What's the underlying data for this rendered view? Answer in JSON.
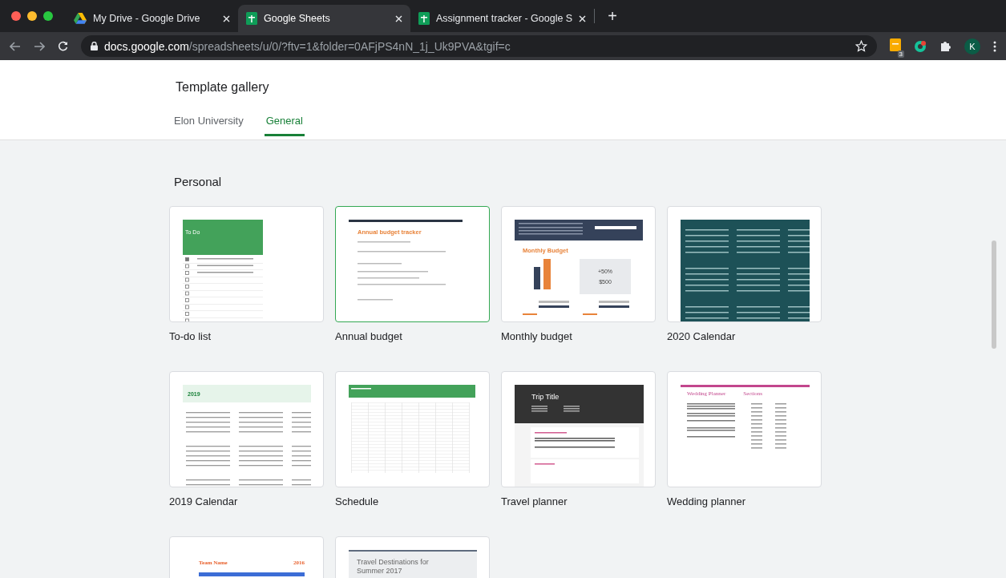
{
  "browser": {
    "tabs": [
      {
        "title": "My Drive - Google Drive",
        "selected": false
      },
      {
        "title": "Google Sheets",
        "selected": true
      },
      {
        "title": "Assignment tracker - Google S",
        "selected": false
      }
    ],
    "new_tab": "+",
    "url_host": "docs.google.com",
    "url_path": "/spreadsheets/u/0/?ftv=1&folder=0AFjPS4nN_1j_Uk9PVA&tgif=c",
    "extension_badge": "3",
    "avatar": "K"
  },
  "page": {
    "title": "Template gallery",
    "tabs": [
      {
        "label": "Elon University",
        "selected": false
      },
      {
        "label": "General",
        "selected": true
      }
    ],
    "section": "Personal",
    "templates": [
      {
        "name": "To-do list",
        "preview": {
          "kind": "todo",
          "title": "To Do",
          "checks": [
            true,
            false,
            false,
            false,
            false,
            false,
            false,
            false,
            false,
            false
          ]
        },
        "selected": false
      },
      {
        "name": "Annual budget",
        "preview": {
          "kind": "annual",
          "title": "Annual budget tracker"
        },
        "selected": true
      },
      {
        "name": "Monthly budget",
        "preview": {
          "kind": "monthly",
          "title": "Monthly Budget",
          "stat_1": "+50%",
          "stat_2": "$500"
        },
        "selected": false
      },
      {
        "name": "2020 Calendar",
        "preview": {
          "kind": "calendar_dark"
        },
        "selected": false
      },
      {
        "name": "2019 Calendar",
        "preview": {
          "kind": "calendar_light",
          "title": "2019"
        },
        "selected": false
      },
      {
        "name": "Schedule",
        "preview": {
          "kind": "schedule"
        },
        "selected": false
      },
      {
        "name": "Travel planner",
        "preview": {
          "kind": "travel",
          "title": "Trip Title"
        },
        "selected": false
      },
      {
        "name": "Wedding planner",
        "preview": {
          "kind": "wedding",
          "title": "Wedding Planner",
          "subtitle": "Sections"
        },
        "selected": false
      },
      {
        "preview": {
          "kind": "team",
          "title": "Team Name",
          "subtitle": "2016"
        },
        "selected": false
      },
      {
        "preview": {
          "kind": "destinations",
          "title": "Travel Destinations for Summer 2017"
        },
        "selected": false
      }
    ]
  }
}
